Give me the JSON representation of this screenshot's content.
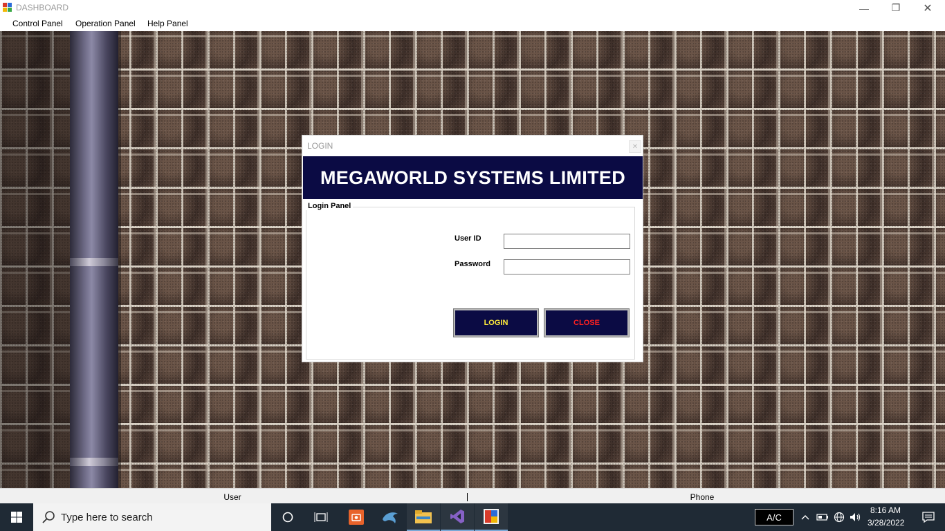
{
  "window": {
    "title": "DASHBOARD",
    "controls": {
      "minimize": "—",
      "maximize": "❐",
      "close": "✕"
    }
  },
  "menu": {
    "items": [
      {
        "label": "Control Panel"
      },
      {
        "label": "Operation Panel"
      },
      {
        "label": "Help Panel"
      }
    ]
  },
  "login_dialog": {
    "title": "LOGIN",
    "close_glyph": "✕",
    "banner": "MEGAWORLD SYSTEMS LIMITED",
    "group_title": "Login Panel",
    "user_id_label": "User ID",
    "user_id_value": "",
    "password_label": "Password",
    "password_value": "",
    "login_button": "LOGIN",
    "close_button": "CLOSE",
    "colors": {
      "banner_bg": "#0b0b44",
      "login_text": "#ffeb3b",
      "close_text": "#ff2020"
    }
  },
  "statusbar": {
    "user": "User",
    "phone": "Phone"
  },
  "taskbar": {
    "search_placeholder": "Type here to search",
    "apps": [
      "cortana-icon",
      "task-view-icon",
      "screen-capture-icon",
      "dolphin-app-icon",
      "file-explorer-icon",
      "visual-studio-icon",
      "dashboard-app-icon"
    ],
    "ac_label": "A/C",
    "time": "8:16 AM",
    "date": "3/28/2022"
  }
}
